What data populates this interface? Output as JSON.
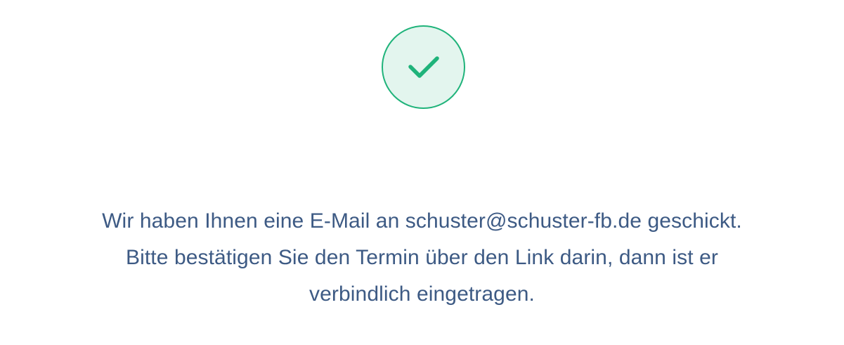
{
  "status": {
    "icon": "checkmark-icon",
    "accent_color": "#1fb37a",
    "badge_background": "#e3f5ee"
  },
  "message": {
    "line1": "Wir haben Ihnen eine E-Mail an schuster@schuster-fb.de geschickt.",
    "line2": "Bitte bestätigen Sie den Termin über den Link darin, dann ist er",
    "line3": "verbindlich eingetragen.",
    "text_color": "#3d5a84"
  }
}
